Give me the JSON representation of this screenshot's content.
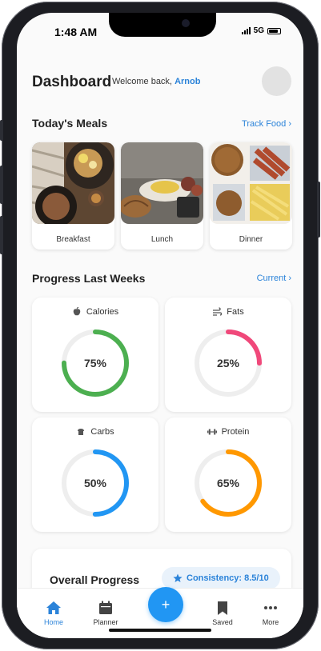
{
  "status": {
    "time": "1:48 AM",
    "network": "5G"
  },
  "header": {
    "title": "Dashboard",
    "welcome_prefix": "Welcome back,",
    "user_name": "Arnob"
  },
  "meals_section": {
    "title": "Today's Meals",
    "link": "Track Food ›",
    "meals": [
      {
        "label": "Breakfast"
      },
      {
        "label": "Lunch"
      },
      {
        "label": "Dinner"
      }
    ]
  },
  "progress_section": {
    "title": "Progress Last Weeks",
    "link": "Current ›",
    "cards": [
      {
        "label": "Calories",
        "value": "75%",
        "fraction": 0.75,
        "color": "#4caf50",
        "icon": "apple-icon"
      },
      {
        "label": "Fats",
        "value": "25%",
        "fraction": 0.25,
        "color": "#f0487a",
        "icon": "wind-icon"
      },
      {
        "label": "Carbs",
        "value": "50%",
        "fraction": 0.5,
        "color": "#2196f3",
        "icon": "bread-icon"
      },
      {
        "label": "Protein",
        "value": "65%",
        "fraction": 0.65,
        "color": "#ff9800",
        "icon": "dumbbell-icon"
      }
    ]
  },
  "overall": {
    "title": "Overall Progress",
    "badge": "Consistency: 8.5/10"
  },
  "tabbar": {
    "accent": "#2b83d9",
    "items": [
      {
        "label": "Home",
        "icon": "home-icon",
        "active": true
      },
      {
        "label": "Planner",
        "icon": "calendar-icon"
      },
      {
        "label": "Saved",
        "icon": "bookmark-icon"
      },
      {
        "label": "More",
        "icon": "more-icon"
      }
    ],
    "fab_label": "+"
  }
}
